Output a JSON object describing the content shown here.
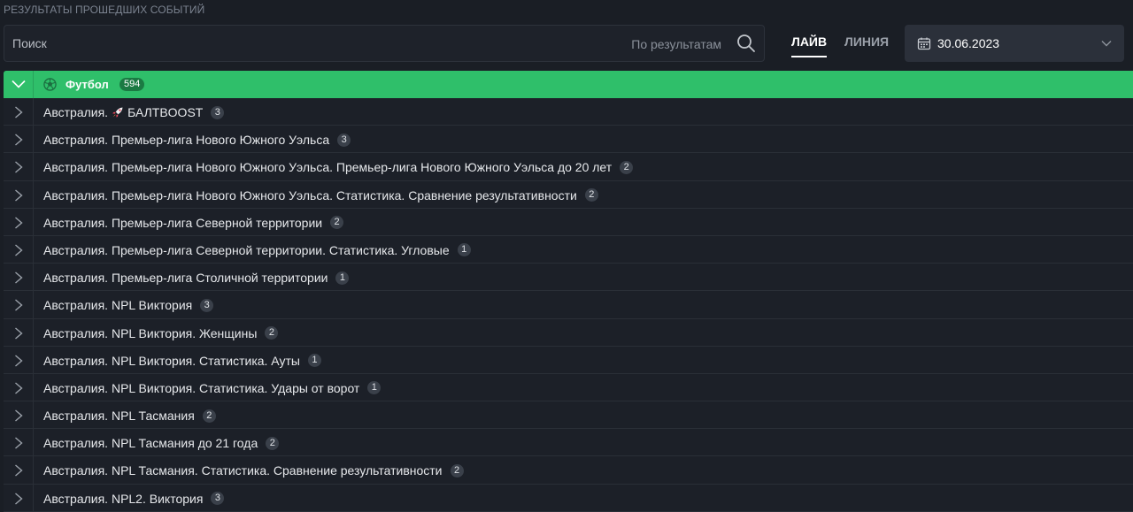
{
  "page": {
    "title": "РЕЗУЛЬТАТЫ ПРОШЕДШИХ СОБЫТИЙ"
  },
  "search": {
    "placeholder": "Поиск",
    "value": "",
    "scope_label": "По результатам"
  },
  "tabs": [
    {
      "label": "ЛАЙВ",
      "active": true
    },
    {
      "label": "ЛИНИЯ",
      "active": false
    }
  ],
  "date": {
    "value": "30.06.2023"
  },
  "colors": {
    "accent": "#2fbf6a",
    "background": "#1a1e25",
    "badge": "#3a404a"
  },
  "sport": {
    "name": "Футбол",
    "count": "594",
    "icon": "soccer-ball-icon",
    "expanded": true
  },
  "leagues": [
    {
      "prefix": "Австралия.",
      "name": "БАЛТBOOST",
      "icon": "rocket-icon",
      "count": "3"
    },
    {
      "prefix": "",
      "name": "Австралия. Премьер-лига Нового Южного Уэльса",
      "count": "3"
    },
    {
      "prefix": "",
      "name": "Австралия. Премьер-лига Нового Южного Уэльса. Премьер-лига Нового Южного Уэльса до 20 лет",
      "count": "2"
    },
    {
      "prefix": "",
      "name": "Австралия. Премьер-лига Нового Южного Уэльса. Статистика. Сравнение результативности",
      "count": "2"
    },
    {
      "prefix": "",
      "name": "Австралия. Премьер-лига Северной территории",
      "count": "2"
    },
    {
      "prefix": "",
      "name": "Австралия. Премьер-лига Северной территории. Статистика. Угловые",
      "count": "1"
    },
    {
      "prefix": "",
      "name": "Австралия. Премьер-лига Столичной территории",
      "count": "1"
    },
    {
      "prefix": "",
      "name": "Австралия. NPL Виктория",
      "count": "3"
    },
    {
      "prefix": "",
      "name": "Австралия. NPL Виктория. Женщины",
      "count": "2"
    },
    {
      "prefix": "",
      "name": "Австралия. NPL Виктория. Статистика. Ауты",
      "count": "1"
    },
    {
      "prefix": "",
      "name": "Австралия. NPL Виктория. Статистика. Удары от ворот",
      "count": "1"
    },
    {
      "prefix": "",
      "name": "Австралия. NPL Тасмания",
      "count": "2"
    },
    {
      "prefix": "",
      "name": "Австралия. NPL Тасмания до 21 года",
      "count": "2"
    },
    {
      "prefix": "",
      "name": "Австралия. NPL Тасмания. Статистика. Сравнение результативности",
      "count": "2"
    },
    {
      "prefix": "",
      "name": "Австралия. NPL2. Виктория",
      "count": "3"
    }
  ]
}
